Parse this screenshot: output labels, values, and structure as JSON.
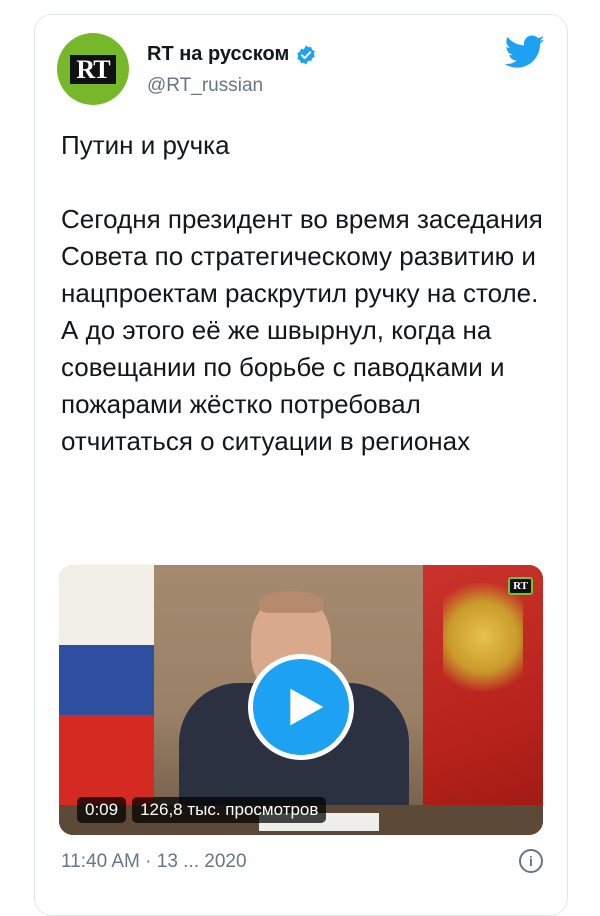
{
  "tweet": {
    "author": {
      "name": "RT на русском",
      "handle": "@RT_russian",
      "avatar_text": "RT",
      "verified": true
    },
    "paragraphs": [
      "Путин и ручка",
      "Сегодня президент во время заседания Совета по стратегическому развитию и нацпроектам раскрутил ручку на столе. А до этого её же швырнул, когда на совещании по борьбе с паводками и пожарами жёстко потребовал отчитаться о ситуации в регионах"
    ],
    "video": {
      "duration": "0:09",
      "views": "126,8 тыс. просмотров",
      "channel_badge": "RT"
    },
    "footer": {
      "timestamp": "11:40 AM · 13 ... 2020"
    }
  },
  "icons": [
    "twitter-bird-icon",
    "verified-icon",
    "play-icon",
    "info-icon"
  ],
  "colors": {
    "accent": "#1da1f2",
    "avatar_bg": "#77b82a",
    "text": "#14171a",
    "secondary_text": "#657786"
  }
}
